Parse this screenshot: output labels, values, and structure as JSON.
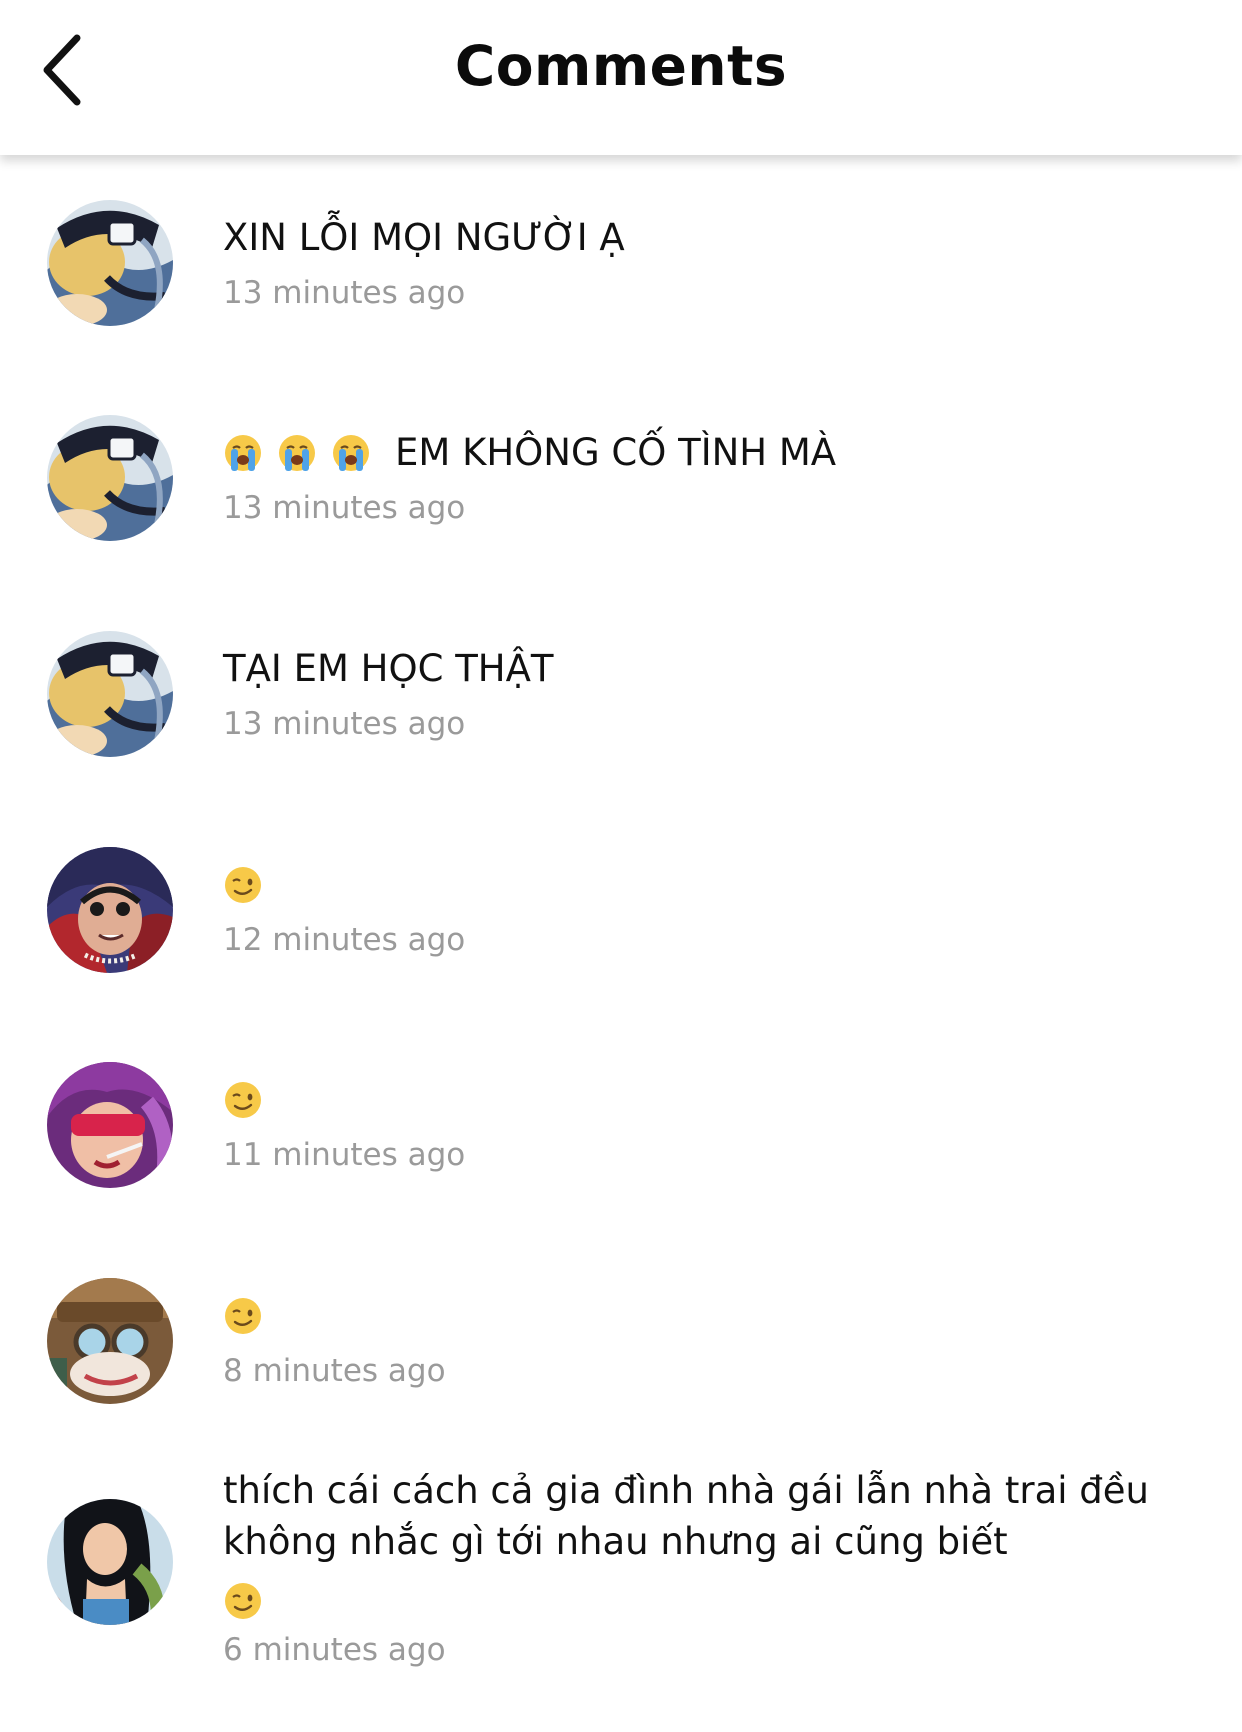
{
  "header": {
    "title": "Comments",
    "back_icon": "chevron-left-icon"
  },
  "comments": [
    {
      "text": "XIN LỖI MỌI NGƯỜI Ạ",
      "time": "13 minutes ago",
      "avatar": "avatar-blond-hat"
    },
    {
      "emojis": [
        "loudly-crying-face",
        "loudly-crying-face",
        "loudly-crying-face"
      ],
      "text": "EM KHÔNG CỐ TÌNH MÀ",
      "time": "13 minutes ago",
      "avatar": "avatar-blond-hat"
    },
    {
      "text": "TẠI EM HỌC THẬT",
      "time": "13 minutes ago",
      "avatar": "avatar-blond-hat"
    },
    {
      "emojis": [
        "winking-face"
      ],
      "time": "12 minutes ago",
      "avatar": "avatar-dark-hair-necklace"
    },
    {
      "emojis": [
        "winking-face"
      ],
      "time": "11 minutes ago",
      "avatar": "avatar-purple-hair-sunglasses"
    },
    {
      "emojis": [
        "winking-face"
      ],
      "time": "8 minutes ago",
      "avatar": "avatar-goggles-hat"
    },
    {
      "text": "thích cái cách cả gia đình nhà gái lẫn nhà trai đều không nhắc gì tới nhau nhưng ai cũng biết",
      "emojis": [
        "winking-face"
      ],
      "time": "6 minutes ago",
      "avatar": "avatar-black-hair-woman"
    }
  ],
  "colors": {
    "timestamp": "#9a9a9a",
    "text": "#111111",
    "background": "#ffffff"
  }
}
